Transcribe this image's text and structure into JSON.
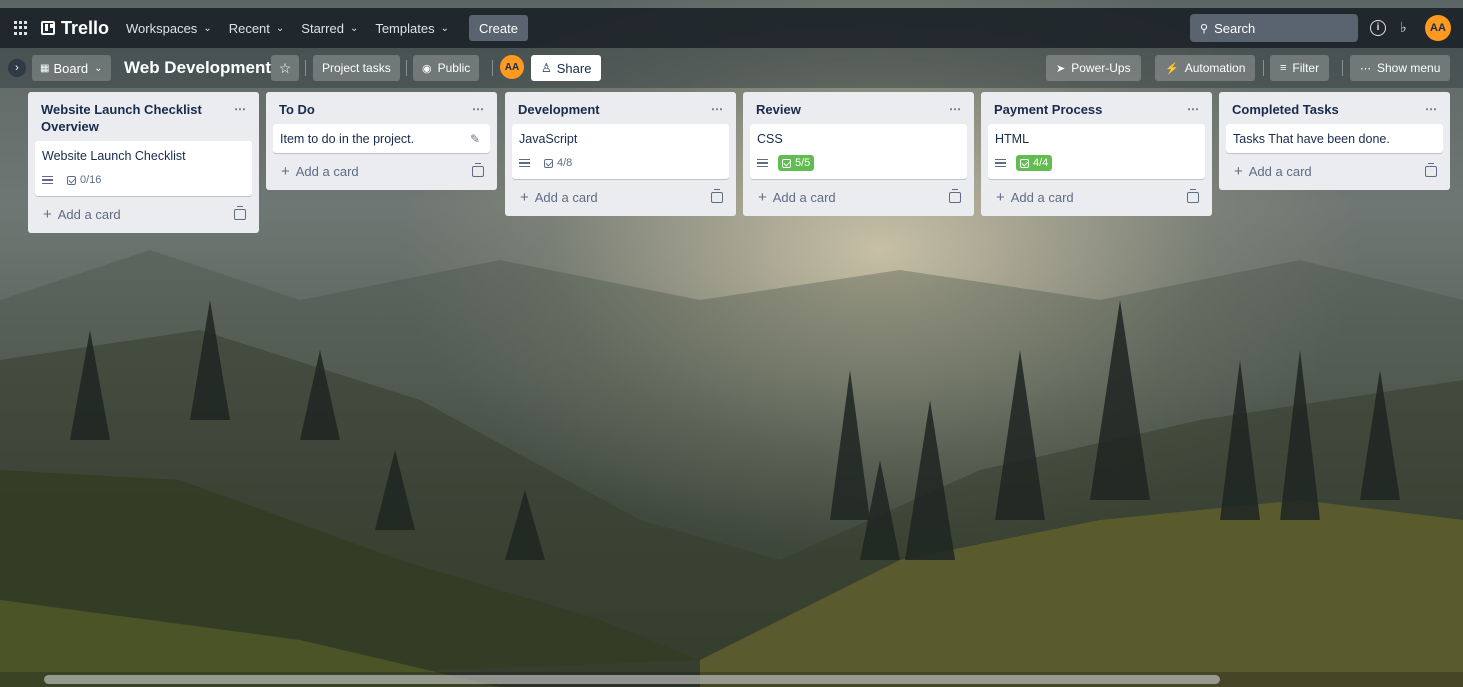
{
  "topnav": {
    "logo": "Trello",
    "items": [
      {
        "label": "Workspaces"
      },
      {
        "label": "Recent"
      },
      {
        "label": "Starred"
      },
      {
        "label": "Templates"
      }
    ],
    "create_label": "Create",
    "search_placeholder": "Search",
    "avatar_initials": "AA"
  },
  "board": {
    "view_label": "Board",
    "title": "Web Development",
    "project_tasks_label": "Project tasks",
    "visibility_label": "Public",
    "member_initials": "AA",
    "share_label": "Share",
    "powerups_label": "Power-Ups",
    "automation_label": "Automation",
    "filter_label": "Filter",
    "show_menu_label": "Show menu"
  },
  "lists": [
    {
      "title": "Website Launch Checklist Overview",
      "cards": [
        {
          "title": "Website Launch Checklist",
          "checklist": "0/16",
          "done": false
        }
      ],
      "add_label": "Add a card"
    },
    {
      "title": "To Do",
      "cards": [
        {
          "title": "Item to do in the project."
        }
      ],
      "add_label": "Add a card"
    },
    {
      "title": "Development",
      "cards": [
        {
          "title": "JavaScript",
          "checklist": "4/8",
          "done": false
        }
      ],
      "add_label": "Add a card"
    },
    {
      "title": "Review",
      "cards": [
        {
          "title": "CSS",
          "checklist": "5/5",
          "done": true
        }
      ],
      "add_label": "Add a card"
    },
    {
      "title": "Payment Process",
      "cards": [
        {
          "title": "HTML",
          "checklist": "4/4",
          "done": true
        }
      ],
      "add_label": "Add a card"
    },
    {
      "title": "Completed Tasks",
      "cards": [
        {
          "title": "Tasks That have been done."
        }
      ],
      "add_label": "Add a card"
    }
  ],
  "colors": {
    "accent": "#ff991f",
    "checklist_done": "#61bd4f",
    "list_bg": "#ebecf0"
  }
}
